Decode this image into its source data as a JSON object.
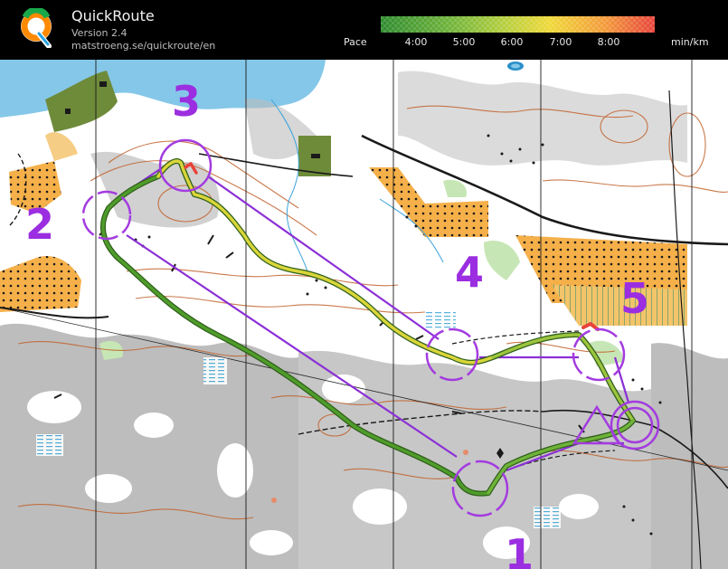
{
  "app": {
    "name": "QuickRoute",
    "version": "Version 2.4",
    "url": "matstroeng.se/quickroute/en"
  },
  "legend": {
    "label": "Pace",
    "unit": "min/km",
    "ticks": [
      "4:00",
      "5:00",
      "6:00",
      "7:00",
      "8:00"
    ],
    "gradient": [
      "#2e8b2e",
      "#6fb33a",
      "#b5cf3e",
      "#f0d838",
      "#f39a3a",
      "#e8433a"
    ]
  },
  "map": {
    "control_numbers": [
      "1",
      "2",
      "3",
      "4",
      "5"
    ],
    "colors": {
      "route": "#8b2fd6",
      "track_green": "#3f7f22",
      "track_yellow": "#e4d83a",
      "water": "#85c7e8",
      "rough_open": "#f5b04a",
      "rock": "#bdbdbd",
      "contour": "#c0622c",
      "field": "#6e8b3a"
    }
  }
}
